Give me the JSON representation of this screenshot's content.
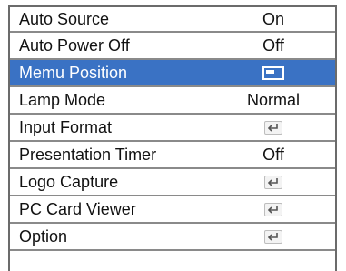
{
  "menu": {
    "items": [
      {
        "label": "Auto Source",
        "value": "On"
      },
      {
        "label": "Auto Power Off",
        "value": "Off"
      },
      {
        "label": "Memu Position",
        "value_icon": "menu-position-icon",
        "selected": true
      },
      {
        "label": "Lamp Mode",
        "value": "Normal"
      },
      {
        "label": "Input Format",
        "value_icon": "enter-icon"
      },
      {
        "label": "Presentation Timer",
        "value": "Off"
      },
      {
        "label": "Logo Capture",
        "value_icon": "enter-icon"
      },
      {
        "label": "PC Card Viewer",
        "value_icon": "enter-icon"
      },
      {
        "label": "Option",
        "value_icon": "enter-icon"
      }
    ]
  },
  "colors": {
    "selected_background": "#3a72c4",
    "border": "#6b6b6b"
  }
}
